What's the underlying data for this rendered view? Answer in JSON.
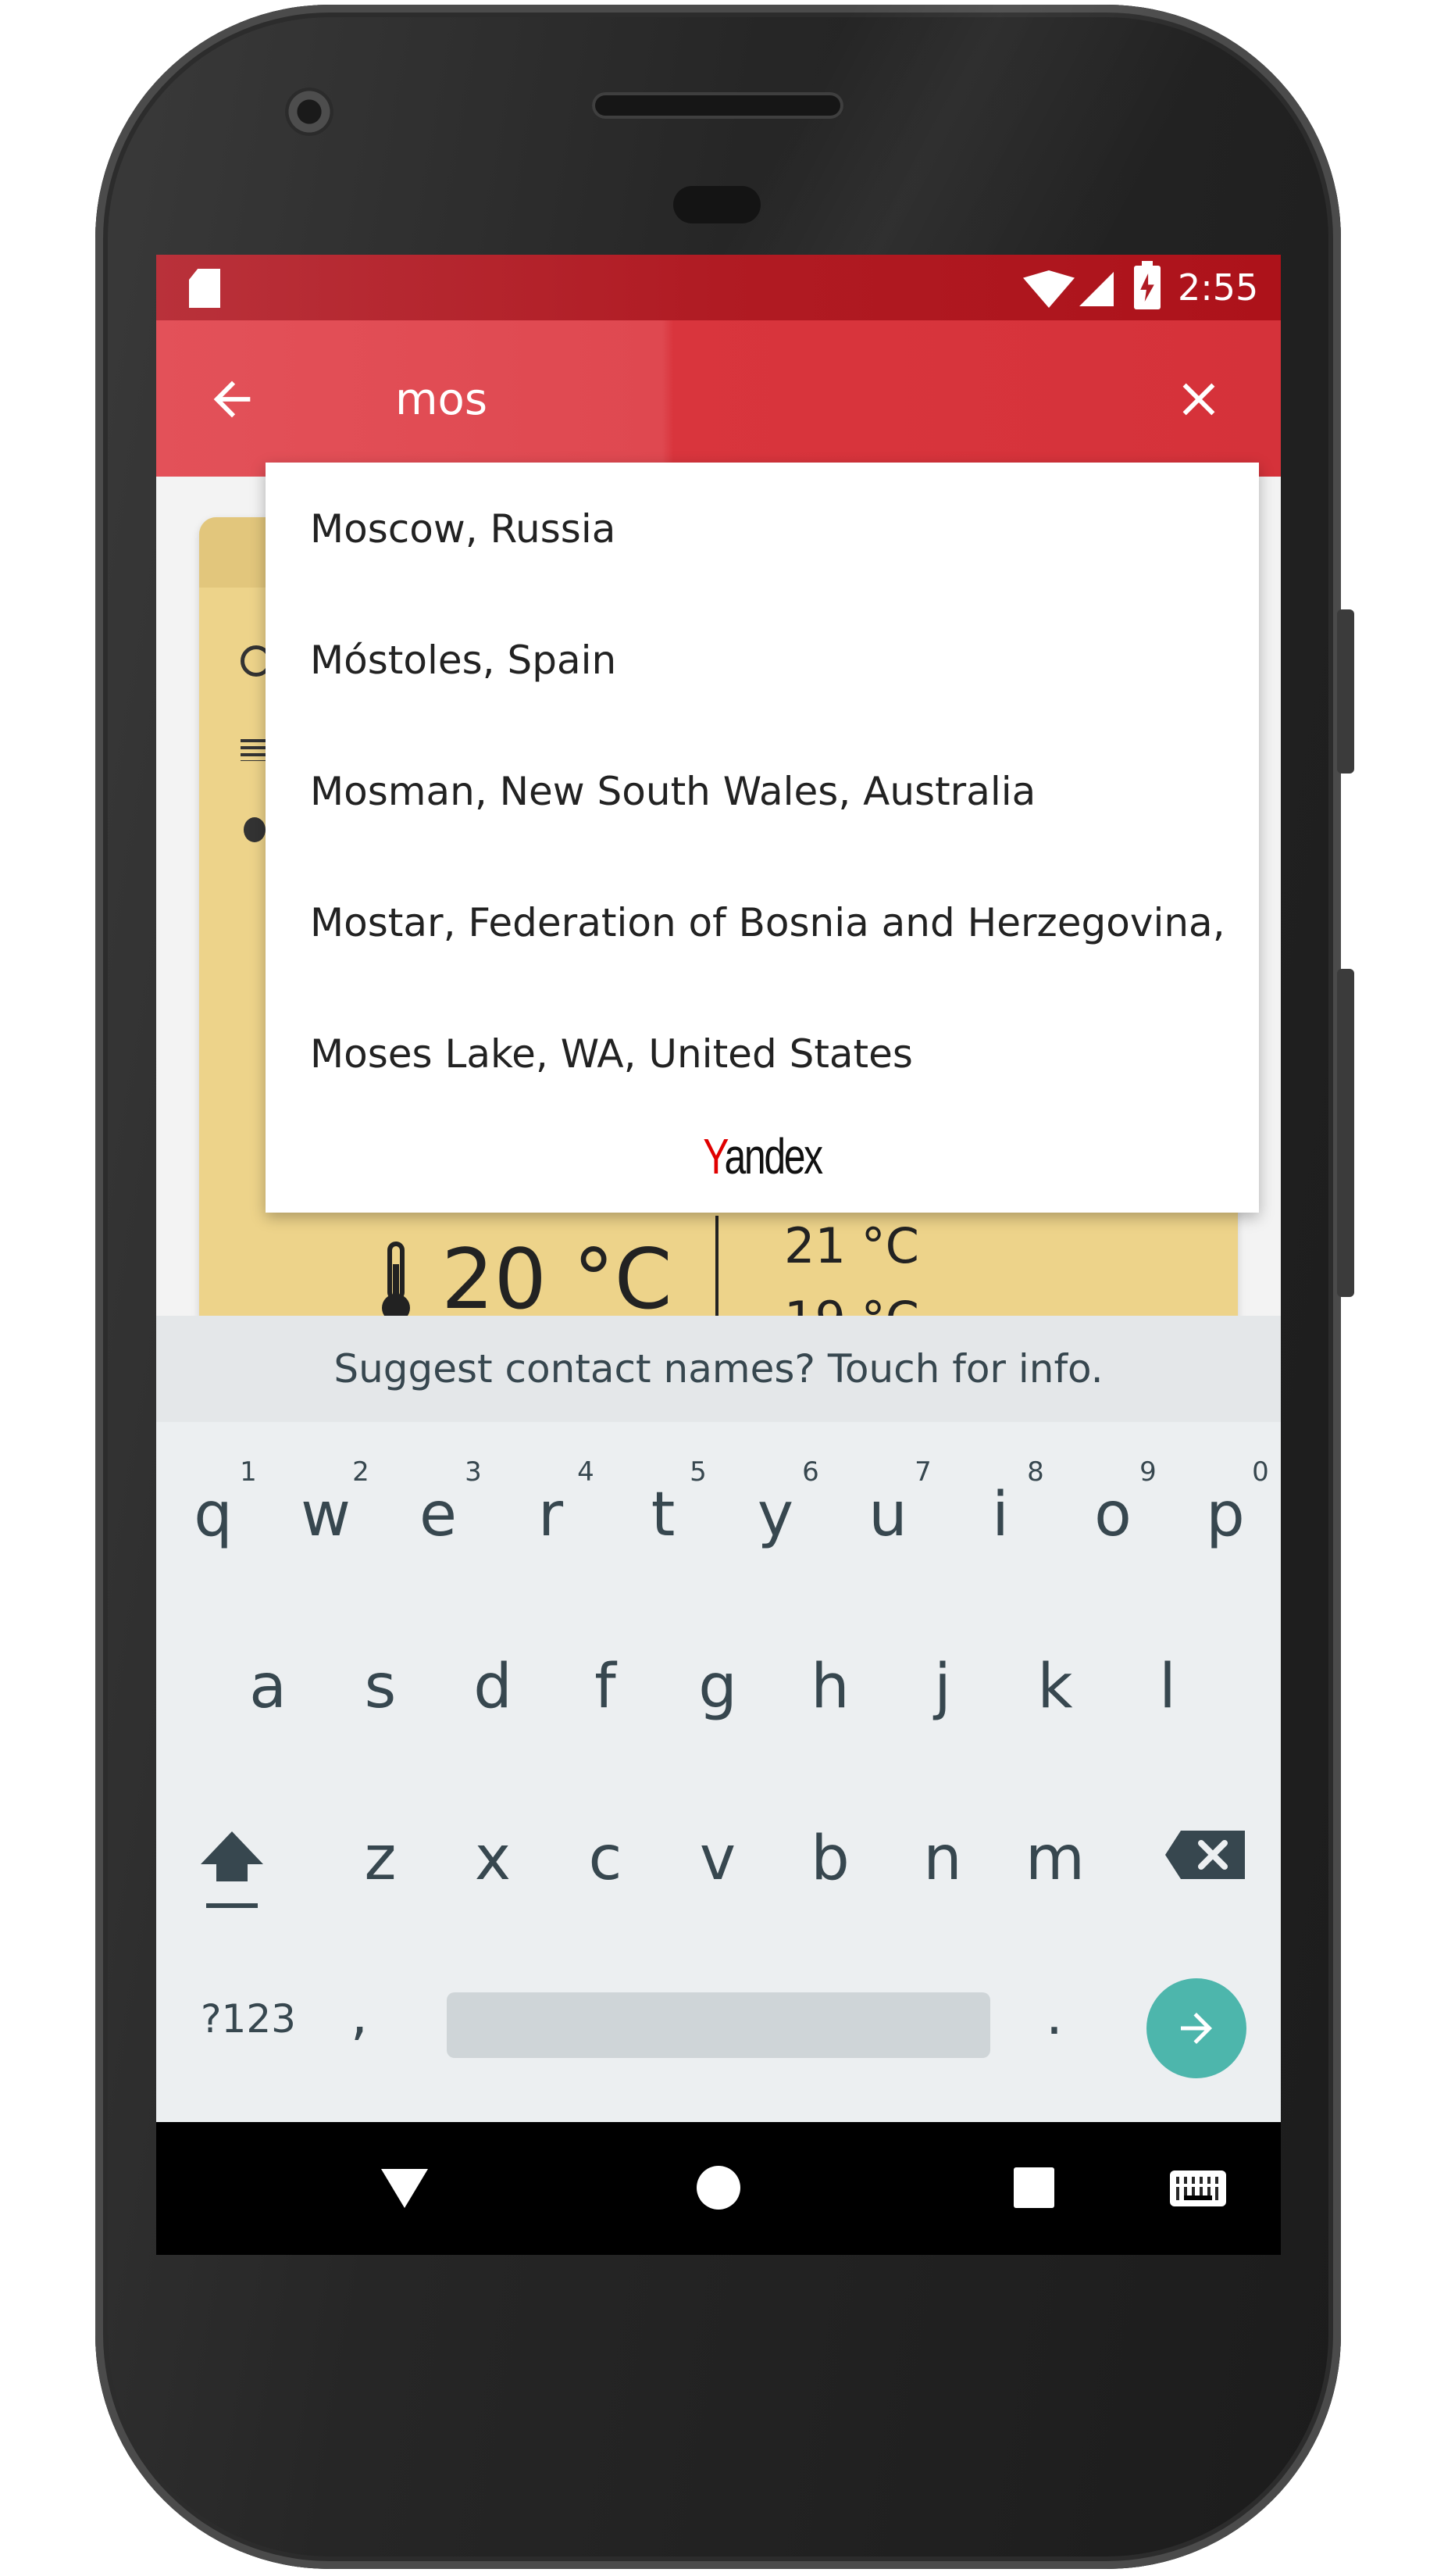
{
  "status_bar": {
    "time": "2:55",
    "icons": [
      "sd-card-icon",
      "wifi-icon",
      "cell-signal-icon",
      "battery-charging-icon"
    ]
  },
  "toolbar": {
    "back_icon": "arrow-back-icon",
    "query": "mos",
    "clear_icon": "close-icon",
    "accent_color": "#d9353d"
  },
  "suggestions": {
    "items": [
      "Moscow, Russia",
      "Móstoles, Spain",
      "Mosman, New South Wales, Australia",
      "Mostar, Federation of Bosnia and Herzegovina,",
      "Moses Lake, WA, United States"
    ],
    "provider_first_letter": "Y",
    "provider_rest": "andex"
  },
  "weather_card": {
    "current_temp": "20 °C",
    "high_temp": "21 °C",
    "low_temp": "19 °C",
    "card_color": "#edd38a"
  },
  "keyboard": {
    "suggest_text": "Suggest contact names? Touch for info.",
    "row1": [
      "q",
      "w",
      "e",
      "r",
      "t",
      "y",
      "u",
      "i",
      "o",
      "p"
    ],
    "row1_numbers": [
      "1",
      "2",
      "3",
      "4",
      "5",
      "6",
      "7",
      "8",
      "9",
      "0"
    ],
    "row2": [
      "a",
      "s",
      "d",
      "f",
      "g",
      "h",
      "j",
      "k",
      "l"
    ],
    "row3": [
      "z",
      "x",
      "c",
      "v",
      "b",
      "n",
      "m"
    ],
    "symbols_label": "?123",
    "comma": ",",
    "period": ".",
    "enter_color": "#4db6ac"
  },
  "nav_bar": {
    "icons": [
      "back-triangle-icon",
      "home-circle-icon",
      "recents-square-icon",
      "keyboard-icon"
    ]
  }
}
